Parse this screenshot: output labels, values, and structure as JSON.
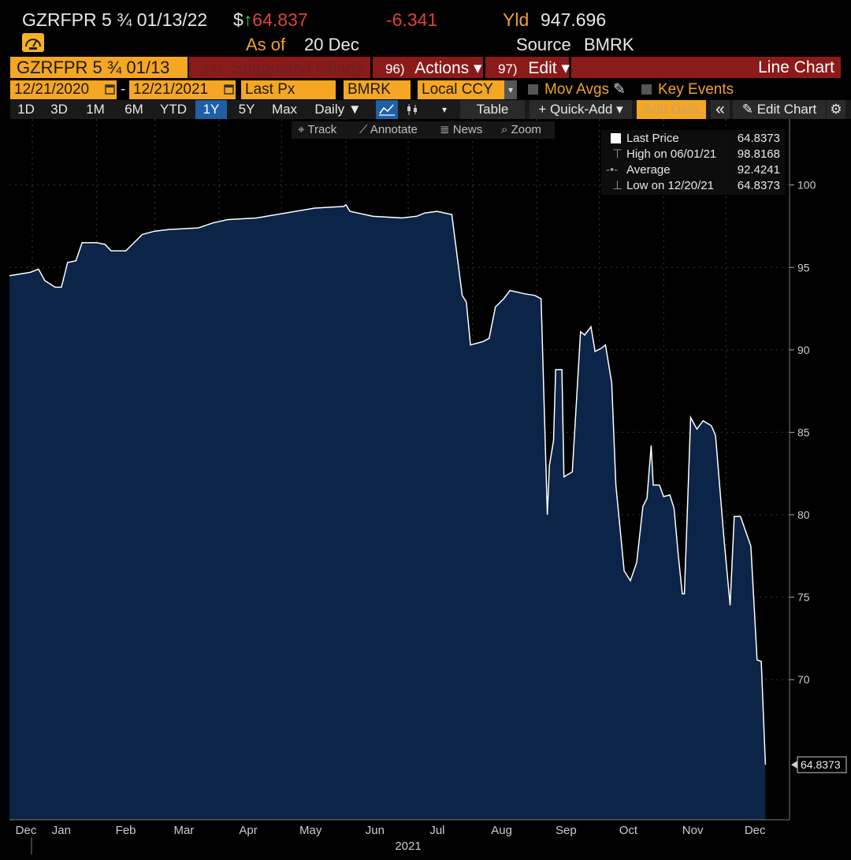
{
  "header": {
    "ticker": "GZRFPR 5 ¾ 01/13/22",
    "currency": "$",
    "arrow": "↑",
    "price": "64.837",
    "change": "-6.341",
    "yld_label": "Yld",
    "yld_value": "947.696",
    "asof_label": "As of",
    "asof_value": "20 Dec",
    "source_label": "Source",
    "source_value": "BMRK"
  },
  "menu": {
    "security": "GZRFPR 5 ¾ 01/13",
    "suggested_num": "94)",
    "suggested": "Suggested Charts",
    "actions_num": "96)",
    "actions": "Actions ▾",
    "edit_num": "97)",
    "edit": "Edit ▾",
    "chart_type": "Line Chart"
  },
  "params": {
    "start_date": "12/21/2020",
    "dash": "-",
    "end_date": "12/21/2021",
    "field": "Last Px",
    "source": "BMRK",
    "currency": "Local CCY",
    "mov_avgs": "Mov Avgs",
    "key_events": "Key Events"
  },
  "toolbar": {
    "periods": [
      "1D",
      "3D",
      "1M",
      "6M",
      "YTD",
      "1Y",
      "5Y",
      "Max"
    ],
    "selected_period": "1Y",
    "frequency": "Daily ▼",
    "table": "Table",
    "quick_add": "+ Quick-Add ▾",
    "add_data": "Add Data",
    "collapse": "«",
    "edit_chart": "Edit Chart",
    "settings": "⚙"
  },
  "chart_tools": {
    "track": "Track",
    "annotate": "Annotate",
    "news": "News",
    "zoom": "Zoom"
  },
  "legend": {
    "rows": [
      {
        "label": "Last Price",
        "value": "64.8373"
      },
      {
        "label": "High on 06/01/21",
        "value": "98.8168"
      },
      {
        "label": "Average",
        "value": "92.4241"
      },
      {
        "label": "Low on 12/20/21",
        "value": "64.8373"
      }
    ]
  },
  "colors": {
    "area_fill": "#0b2447",
    "line": "#ffffff",
    "accent_orange": "#f5a623",
    "menu_red": "#8b1a1a",
    "price_down": "#e0403c",
    "arrow_up": "#35d84a"
  },
  "chart_data": {
    "type": "area",
    "series": [
      {
        "name": "Last Price",
        "points": [
          [
            "2020-12-21",
            94.5
          ],
          [
            "2020-12-31",
            94.7
          ],
          [
            "2021-01-04",
            94.9
          ],
          [
            "2021-01-07",
            94.2
          ],
          [
            "2021-01-12",
            93.8
          ],
          [
            "2021-01-15",
            93.8
          ],
          [
            "2021-01-18",
            95.3
          ],
          [
            "2021-01-22",
            95.4
          ],
          [
            "2021-01-25",
            96.5
          ],
          [
            "2021-02-01",
            96.5
          ],
          [
            "2021-02-05",
            96.4
          ],
          [
            "2021-02-08",
            96.0
          ],
          [
            "2021-02-15",
            96.0
          ],
          [
            "2021-02-19",
            96.5
          ],
          [
            "2021-02-23",
            97.0
          ],
          [
            "2021-03-01",
            97.2
          ],
          [
            "2021-03-08",
            97.3
          ],
          [
            "2021-03-22",
            97.4
          ],
          [
            "2021-03-29",
            97.7
          ],
          [
            "2021-04-05",
            97.9
          ],
          [
            "2021-04-19",
            98.0
          ],
          [
            "2021-05-03",
            98.3
          ],
          [
            "2021-05-17",
            98.6
          ],
          [
            "2021-05-31",
            98.7
          ],
          [
            "2021-06-01",
            98.8
          ],
          [
            "2021-06-03",
            98.4
          ],
          [
            "2021-06-14",
            98.1
          ],
          [
            "2021-06-28",
            98.0
          ],
          [
            "2021-07-05",
            98.1
          ],
          [
            "2021-07-09",
            98.3
          ],
          [
            "2021-07-15",
            98.4
          ],
          [
            "2021-07-22",
            98.2
          ],
          [
            "2021-07-27",
            93.3
          ],
          [
            "2021-07-29",
            92.9
          ],
          [
            "2021-07-31",
            90.3
          ],
          [
            "2021-08-06",
            90.5
          ],
          [
            "2021-08-09",
            90.7
          ],
          [
            "2021-08-12",
            92.6
          ],
          [
            "2021-08-16",
            93.1
          ],
          [
            "2021-08-19",
            93.6
          ],
          [
            "2021-08-26",
            93.4
          ],
          [
            "2021-08-31",
            93.3
          ],
          [
            "2021-09-03",
            93.1
          ],
          [
            "2021-09-06",
            80.0
          ],
          [
            "2021-09-07",
            83.0
          ],
          [
            "2021-09-09",
            84.5
          ],
          [
            "2021-09-10",
            88.8
          ],
          [
            "2021-09-13",
            88.8
          ],
          [
            "2021-09-14",
            82.3
          ],
          [
            "2021-09-18",
            82.6
          ],
          [
            "2021-09-22",
            91.1
          ],
          [
            "2021-09-24",
            90.9
          ],
          [
            "2021-09-27",
            91.4
          ],
          [
            "2021-09-29",
            89.9
          ],
          [
            "2021-10-02",
            90.1
          ],
          [
            "2021-10-04",
            90.3
          ],
          [
            "2021-10-07",
            88.0
          ],
          [
            "2021-10-09",
            81.8
          ],
          [
            "2021-10-13",
            76.6
          ],
          [
            "2021-10-16",
            76.0
          ],
          [
            "2021-10-19",
            77.1
          ],
          [
            "2021-10-22",
            80.5
          ],
          [
            "2021-10-24",
            81.0
          ],
          [
            "2021-10-26",
            84.2
          ],
          [
            "2021-10-27",
            81.8
          ],
          [
            "2021-10-30",
            81.8
          ],
          [
            "2021-11-01",
            81.1
          ],
          [
            "2021-11-04",
            81.2
          ],
          [
            "2021-11-06",
            80.4
          ],
          [
            "2021-11-08",
            77.6
          ],
          [
            "2021-11-10",
            75.2
          ],
          [
            "2021-11-11",
            75.2
          ],
          [
            "2021-11-14",
            85.9
          ],
          [
            "2021-11-17",
            85.2
          ],
          [
            "2021-11-20",
            85.7
          ],
          [
            "2021-11-24",
            85.4
          ],
          [
            "2021-11-26",
            84.8
          ],
          [
            "2021-11-30",
            78.6
          ],
          [
            "2021-12-03",
            74.5
          ],
          [
            "2021-12-05",
            79.9
          ],
          [
            "2021-12-08",
            79.9
          ],
          [
            "2021-12-13",
            78.1
          ],
          [
            "2021-12-16",
            71.2
          ],
          [
            "2021-12-18",
            71.1
          ],
          [
            "2021-12-20",
            64.84
          ]
        ]
      }
    ],
    "x_range": [
      "2020-12-21",
      "2021-12-21"
    ],
    "ylim": [
      61.5,
      104
    ],
    "y_ticks": [
      70,
      75,
      80,
      85,
      90,
      95,
      100
    ],
    "x_ticks": [
      {
        "label": "Dec",
        "date": "2020-12-15"
      },
      {
        "label": "Jan",
        "date": "2021-01-15"
      },
      {
        "label": "Feb",
        "date": "2021-02-15"
      },
      {
        "label": "Mar",
        "date": "2021-03-15"
      },
      {
        "label": "Apr",
        "date": "2021-04-15"
      },
      {
        "label": "May",
        "date": "2021-05-15"
      },
      {
        "label": "Jun",
        "date": "2021-06-15"
      },
      {
        "label": "Jul",
        "date": "2021-07-15"
      },
      {
        "label": "Aug",
        "date": "2021-08-15"
      },
      {
        "label": "Sep",
        "date": "2021-09-15"
      },
      {
        "label": "Oct",
        "date": "2021-10-15"
      },
      {
        "label": "Nov",
        "date": "2021-11-15"
      },
      {
        "label": "Dec",
        "date": "2021-12-15"
      }
    ],
    "year_label": "2021",
    "last_value_label": "64.8373",
    "grid": true,
    "y_axis_side": "right",
    "legend_position": "top-right"
  }
}
